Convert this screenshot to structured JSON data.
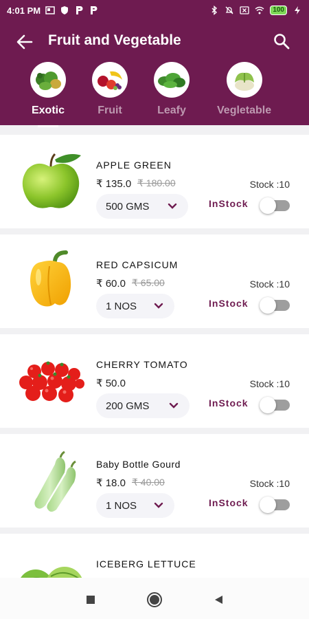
{
  "status_bar": {
    "time": "4:01 PM",
    "battery": "100"
  },
  "header": {
    "title": "Fruit and Vegetable"
  },
  "categories": [
    {
      "label": "Exotic",
      "active": true
    },
    {
      "label": "Fruit",
      "active": false
    },
    {
      "label": "Leafy",
      "active": false
    },
    {
      "label": "Vegletable",
      "active": false
    }
  ],
  "products": [
    {
      "name": "APPLE GREEN",
      "price": "₹ 135.0",
      "mrp": "₹ 180.00",
      "qty": "500 GMS",
      "stock": "Stock :10",
      "status": "InStock"
    },
    {
      "name": "RED CAPSICUM",
      "price": "₹ 60.0",
      "mrp": "₹ 65.00",
      "qty": "1 NOS",
      "stock": "Stock :10",
      "status": "InStock"
    },
    {
      "name": "CHERRY TOMATO",
      "price": "₹ 50.0",
      "mrp": "",
      "qty": "200 GMS",
      "stock": "Stock :10",
      "status": "InStock"
    },
    {
      "name": "Baby Bottle Gourd",
      "price": "₹ 18.0",
      "mrp": "₹ 40.00",
      "qty": "1 NOS",
      "stock": "Stock :10",
      "status": "InStock"
    },
    {
      "name": "ICEBERG LETTUCE"
    }
  ],
  "colors": {
    "brand": "#6e1b50",
    "toggle_off": "#9e9e9e"
  }
}
